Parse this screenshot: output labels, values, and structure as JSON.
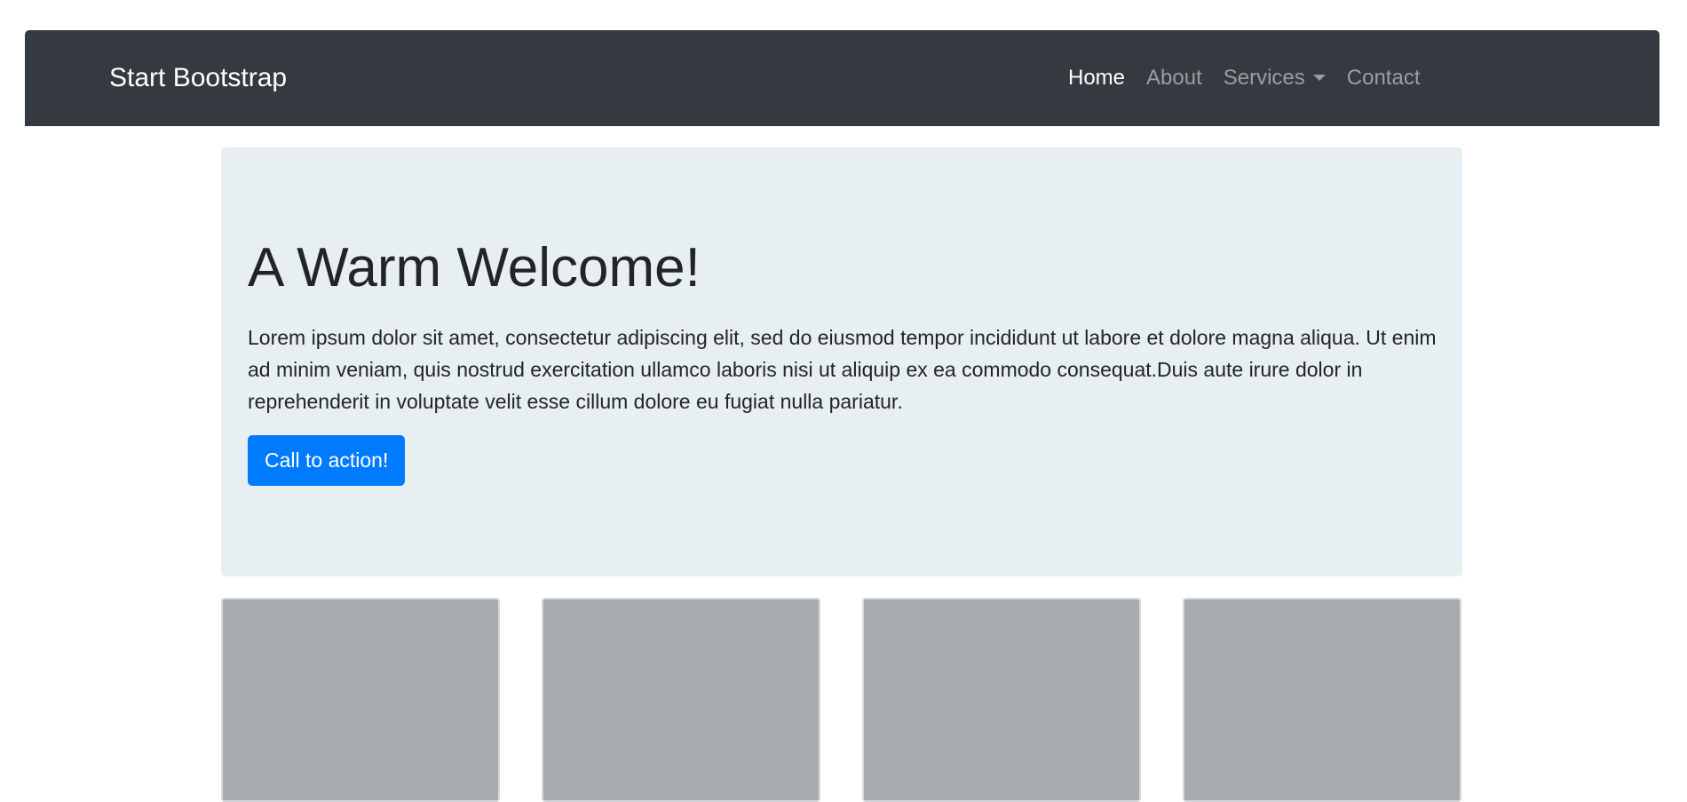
{
  "navbar": {
    "brand": "Start Bootstrap",
    "items": [
      {
        "label": "Home",
        "active": true
      },
      {
        "label": "About"
      },
      {
        "label": "Services",
        "dropdown": true
      },
      {
        "label": "Contact"
      }
    ]
  },
  "hero": {
    "title": "A Warm Welcome!",
    "text": "Lorem ipsum dolor sit amet, consectetur adipiscing elit, sed do eiusmod tempor incididunt ut labore et dolore magna aliqua. Ut enim ad minim veniam, quis nostrud exercitation ullamco laboris nisi ut aliquip ex ea commodo consequat.Duis aute irure dolor in reprehenderit in voluptate velit esse cillum dolore eu fugiat nulla pariatur.",
    "cta_label": "Call to action!"
  },
  "colors": {
    "navbar_bg": "#343a40",
    "hero_bg": "#e7eff2",
    "primary": "#007bff",
    "card_placeholder": "#a6abad"
  },
  "icons": {
    "dropdown": "chevron-down-icon"
  }
}
